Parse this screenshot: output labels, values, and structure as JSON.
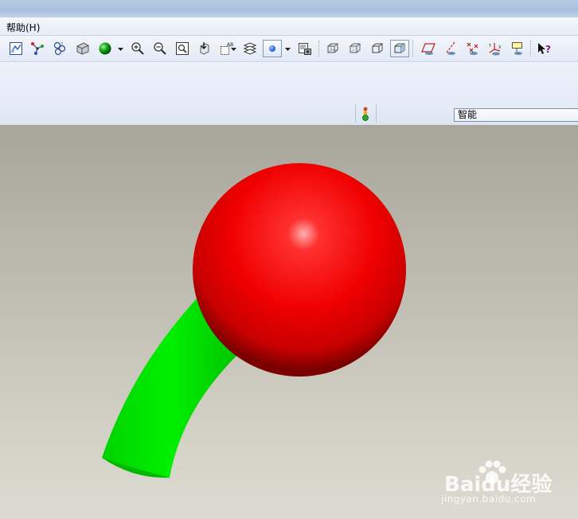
{
  "menu": {
    "items": [
      {
        "label": "帮助(H)"
      }
    ]
  },
  "toolbar": {
    "buttons": [
      {
        "id": "display-style",
        "icon": "display-style-icon"
      },
      {
        "id": "datum-points",
        "icon": "datum-point-icon"
      },
      {
        "id": "saved-views",
        "icon": "saved-views-icon"
      },
      {
        "id": "layers",
        "icon": "layer-tree-icon"
      },
      {
        "id": "appearance",
        "icon": "appearance-sphere-icon"
      },
      {
        "id": "zoom-in",
        "icon": "zoom-in-icon"
      },
      {
        "id": "zoom-out",
        "icon": "zoom-out-icon"
      },
      {
        "id": "refit",
        "icon": "refit-icon"
      },
      {
        "id": "reorient",
        "icon": "reorient-icon"
      },
      {
        "id": "named-views",
        "icon": "named-views-icon"
      },
      {
        "id": "layers-stack",
        "icon": "layers-stack-icon"
      },
      {
        "id": "spin-center",
        "icon": "spin-center-icon"
      },
      {
        "id": "render-window",
        "icon": "render-window-icon"
      },
      {
        "id": "wireframe",
        "icon": "wireframe-icon"
      },
      {
        "id": "hidden-line",
        "icon": "hidden-line-icon"
      },
      {
        "id": "no-hidden",
        "icon": "no-hidden-icon"
      },
      {
        "id": "shading",
        "icon": "shading-icon"
      },
      {
        "id": "datum-planes",
        "icon": "datum-plane-icon"
      },
      {
        "id": "datum-axes",
        "icon": "datum-axis-icon"
      },
      {
        "id": "datum-points-toggle",
        "icon": "datum-point-toggle-icon"
      },
      {
        "id": "coordinate-systems",
        "icon": "coordinate-system-icon"
      },
      {
        "id": "annotations",
        "icon": "annotation-icon"
      },
      {
        "id": "context-help",
        "icon": "context-help-icon"
      }
    ]
  },
  "status": {
    "indicator_icon": "traffic-light-icon"
  },
  "filter": {
    "selected": "智能"
  },
  "watermark": {
    "main": "Baidu经验",
    "sub": "jingyan.baidu.com"
  },
  "colors": {
    "sphere": "#ff0000",
    "tube": "#00e000",
    "background_top": "#a8a59a",
    "background_bottom": "#dcdbd1"
  }
}
